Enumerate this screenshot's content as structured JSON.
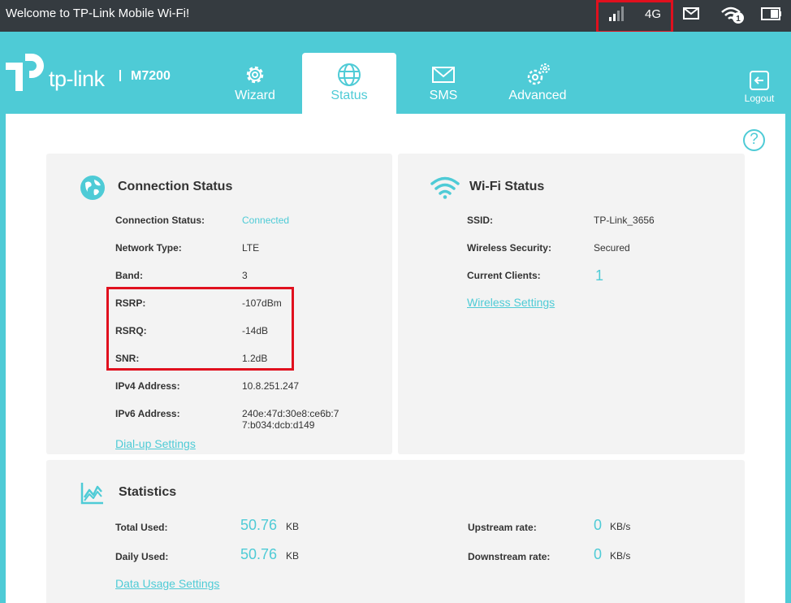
{
  "topbar": {
    "welcome": "Welcome to TP-Link Mobile Wi-Fi!",
    "network_type": "4G",
    "wifi_clients_badge": "1"
  },
  "header": {
    "brand": "tp-link",
    "model": "M7200",
    "tabs": [
      {
        "label": "Wizard",
        "icon": "gear-icon"
      },
      {
        "label": "Status",
        "icon": "globe-icon"
      },
      {
        "label": "SMS",
        "icon": "envelope-icon"
      },
      {
        "label": "Advanced",
        "icon": "gears-icon"
      }
    ],
    "logout": "Logout"
  },
  "help": "?",
  "connection": {
    "title": "Connection Status",
    "rows": [
      {
        "label": "Connection Status:",
        "value": "Connected"
      },
      {
        "label": "Network Type:",
        "value": "LTE"
      },
      {
        "label": "Band:",
        "value": "3"
      },
      {
        "label": "RSRP:",
        "value": "-107dBm"
      },
      {
        "label": "RSRQ:",
        "value": "-14dB"
      },
      {
        "label": "SNR:",
        "value": "1.2dB"
      },
      {
        "label": "IPv4 Address:",
        "value": "10.8.251.247"
      },
      {
        "label": "IPv6 Address:",
        "value_line1": "240e:47d:30e8:ce6b:7",
        "value_line2": "7:b034:dcb:d149"
      }
    ],
    "link": "Dial-up Settings"
  },
  "wifi": {
    "title": "Wi-Fi Status",
    "rows": [
      {
        "label": "SSID:",
        "value": "TP-Link_3656"
      },
      {
        "label": "Wireless Security:",
        "value": "Secured"
      },
      {
        "label": "Current Clients:",
        "value": "1"
      }
    ],
    "link": "Wireless Settings"
  },
  "statistics": {
    "title": "Statistics",
    "total_used_label": "Total Used:",
    "total_used_value": "50.76",
    "total_used_unit": "KB",
    "daily_used_label": "Daily Used:",
    "daily_used_value": "50.76",
    "daily_used_unit": "KB",
    "upstream_label": "Upstream rate:",
    "upstream_value": "0",
    "upstream_unit": "KB/s",
    "downstream_label": "Downstream rate:",
    "downstream_value": "0",
    "downstream_unit": "KB/s",
    "link": "Data Usage Settings"
  },
  "colors": {
    "accent": "#4ecbd6",
    "topbar": "#353b40",
    "highlight": "#e0101e",
    "card": "#f3f3f3"
  }
}
